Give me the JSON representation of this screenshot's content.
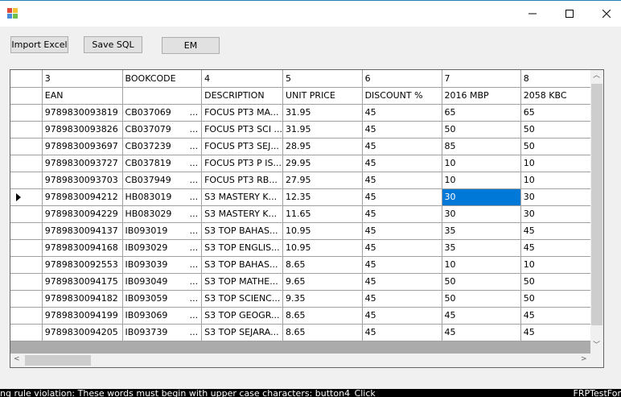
{
  "window": {
    "title_icon": "app-icon"
  },
  "toolbar": {
    "import_label": "Import Excel",
    "save_label": "Save SQL",
    "em_label": "EM"
  },
  "grid": {
    "header_row": [
      "3",
      "BOOKCODE",
      "4",
      "5",
      "6",
      "7",
      "8"
    ],
    "subheader_row": [
      "EAN",
      "",
      "DESCRIPTION",
      "UNIT PRICE",
      "DISCOUNT %",
      "2016 MBP",
      "2058 KBC"
    ],
    "rows": [
      [
        "9789830093819",
        "CB037069",
        "FOCUS PT3 MA...",
        "31.95",
        "45",
        "65",
        "65"
      ],
      [
        "9789830093826",
        "CB037079",
        "FOCUS PT3 SCI ...",
        "31.95",
        "45",
        "50",
        "50"
      ],
      [
        "9789830093697",
        "CB037239",
        "FOCUS PT3 SEJ...",
        "28.95",
        "45",
        "85",
        "50"
      ],
      [
        "9789830093727",
        "CB037819",
        "FOCUS PT3 P IS...",
        "29.95",
        "45",
        "10",
        "10"
      ],
      [
        "9789830093703",
        "CB037949",
        "FOCUS PT3 RB...",
        "27.95",
        "45",
        "10",
        "10"
      ],
      [
        "9789830094212",
        "HB083019",
        "S3 MASTERY K...",
        "12.35",
        "45",
        "30",
        "30"
      ],
      [
        "9789830094229",
        "HB083029",
        "S3 MASTERY K...",
        "11.65",
        "45",
        "30",
        "30"
      ],
      [
        "9789830094137",
        "IB093019",
        "S3 TOP BAHAS...",
        "10.95",
        "45",
        "35",
        "45"
      ],
      [
        "9789830094168",
        "IB093029",
        "S3 TOP ENGLIS...",
        "10.95",
        "45",
        "35",
        "45"
      ],
      [
        "9789830092553",
        "IB093039",
        "S3 TOP BAHAS...",
        "8.65",
        "45",
        "10",
        "10"
      ],
      [
        "9789830094175",
        "IB093049",
        "S3 TOP MATHE...",
        "9.65",
        "45",
        "50",
        "50"
      ],
      [
        "9789830094182",
        "IB093059",
        "S3 TOP SCIENC...",
        "9.35",
        "45",
        "50",
        "50"
      ],
      [
        "9789830094199",
        "IB093069",
        "S3 TOP GEOGR...",
        "8.65",
        "45",
        "45",
        "45"
      ],
      [
        "9789830094205",
        "IB093739",
        "S3 TOP SEJARA...",
        "8.65",
        "45",
        "45",
        "45"
      ]
    ],
    "bookcode_ellipsis": "...",
    "selected_row_index": 5,
    "selected_col_index": 5
  },
  "status": {
    "left_text": "ng rule violation: These words must begin with upper case characters: button4_Click",
    "right_text": "FRPTestFor"
  },
  "colors": {
    "selection": "#0078d7",
    "status_bg": "#000000"
  }
}
